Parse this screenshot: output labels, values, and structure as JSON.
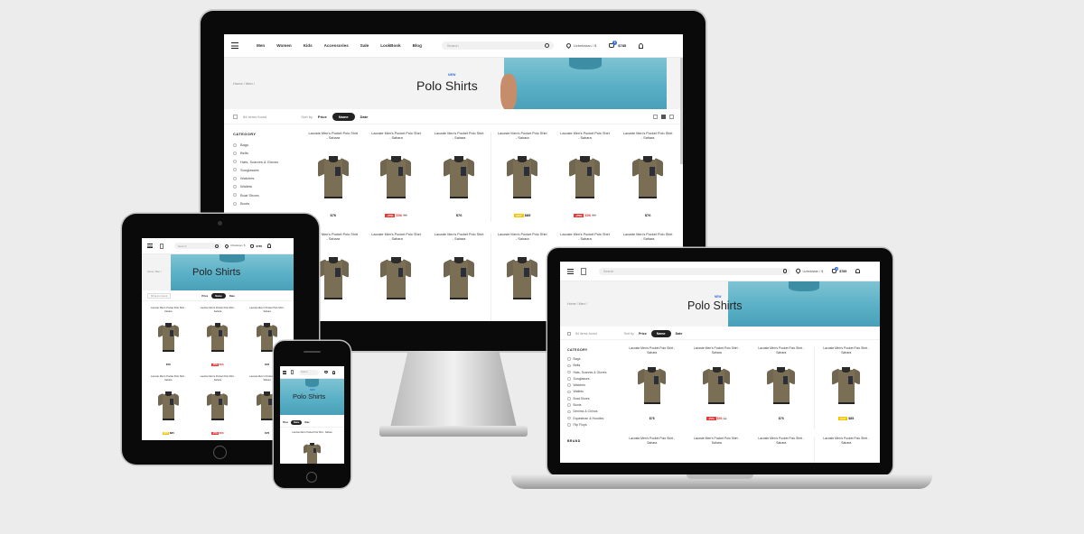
{
  "site": {
    "nav_items": [
      "Men",
      "Women",
      "Kids",
      "Accessories",
      "Sale",
      "LookBook",
      "Blog"
    ],
    "search_placeholder": "Search",
    "location": "Uzbekistan / $",
    "cart_total": "$785",
    "cart_count": "1"
  },
  "hero": {
    "breadcrumb": "Home / Men /",
    "tag": "NEW",
    "title": "Polo Shirts"
  },
  "toolbar": {
    "items_found": "84 items found",
    "sort_label": "Sort by",
    "sort_price": "Price",
    "sort_name": "Name",
    "sort_date": "Date"
  },
  "sidebar": {
    "category_head": "CATEGORY",
    "brand_head": "BRAND",
    "categories": [
      "Bags",
      "Belts",
      "Hats, Scarves & Gloves",
      "Sunglasses",
      "Watches",
      "Wallets",
      "Boat Shoes",
      "Boots",
      "Denims & Chinos",
      "Equestrian & Hoodies",
      "Flip Flops"
    ]
  },
  "product": {
    "name": "Lacoste Men's Pocket Polo Shirt - Sahara"
  },
  "prices": {
    "regular": "$76",
    "sale": "$56",
    "old": "$8",
    "sale_tag": "-25%",
    "hot_tag": "HOT",
    "alt": "$85"
  },
  "colors": {
    "accent": "#2f6fd6",
    "sale": "#e53935",
    "hot": "#f5c400",
    "shirt": "#7a6e55"
  }
}
